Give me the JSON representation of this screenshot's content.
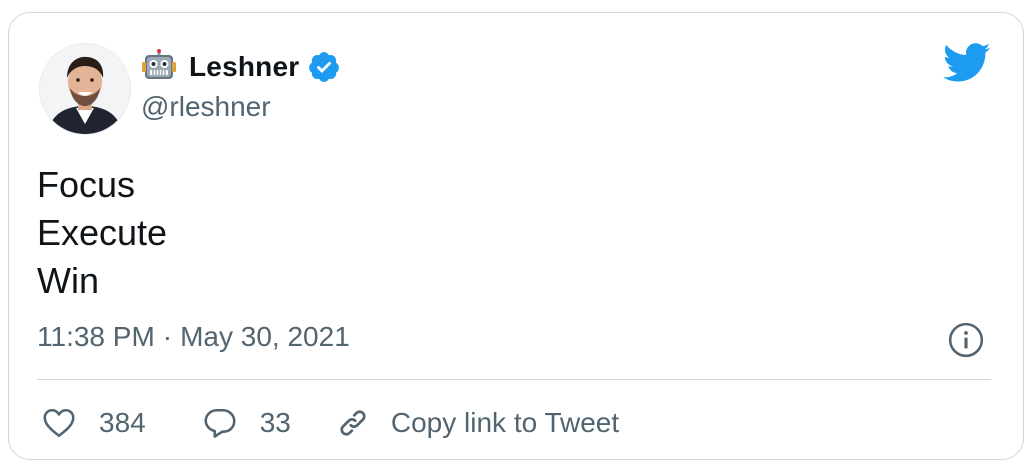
{
  "author": {
    "display_name": "Leshner",
    "handle": "@rleshner",
    "name_emoji": "robot-face",
    "verified": true
  },
  "tweet": {
    "lines": [
      "Focus",
      "Execute",
      "Win"
    ],
    "time": "11:38 PM",
    "separator": "·",
    "date": "May 30, 2021"
  },
  "actions": {
    "like_count": "384",
    "reply_count": "33",
    "copy_label": "Copy link to Tweet"
  },
  "icons": {
    "brand": "twitter-bird",
    "info": "info-circle",
    "like": "heart-outline",
    "reply": "speech-bubble",
    "copy": "link-chain"
  },
  "colors": {
    "brand_blue": "#1d9bf0",
    "text_primary": "#0f1419",
    "text_secondary": "#536471",
    "border": "#cfd9de"
  }
}
